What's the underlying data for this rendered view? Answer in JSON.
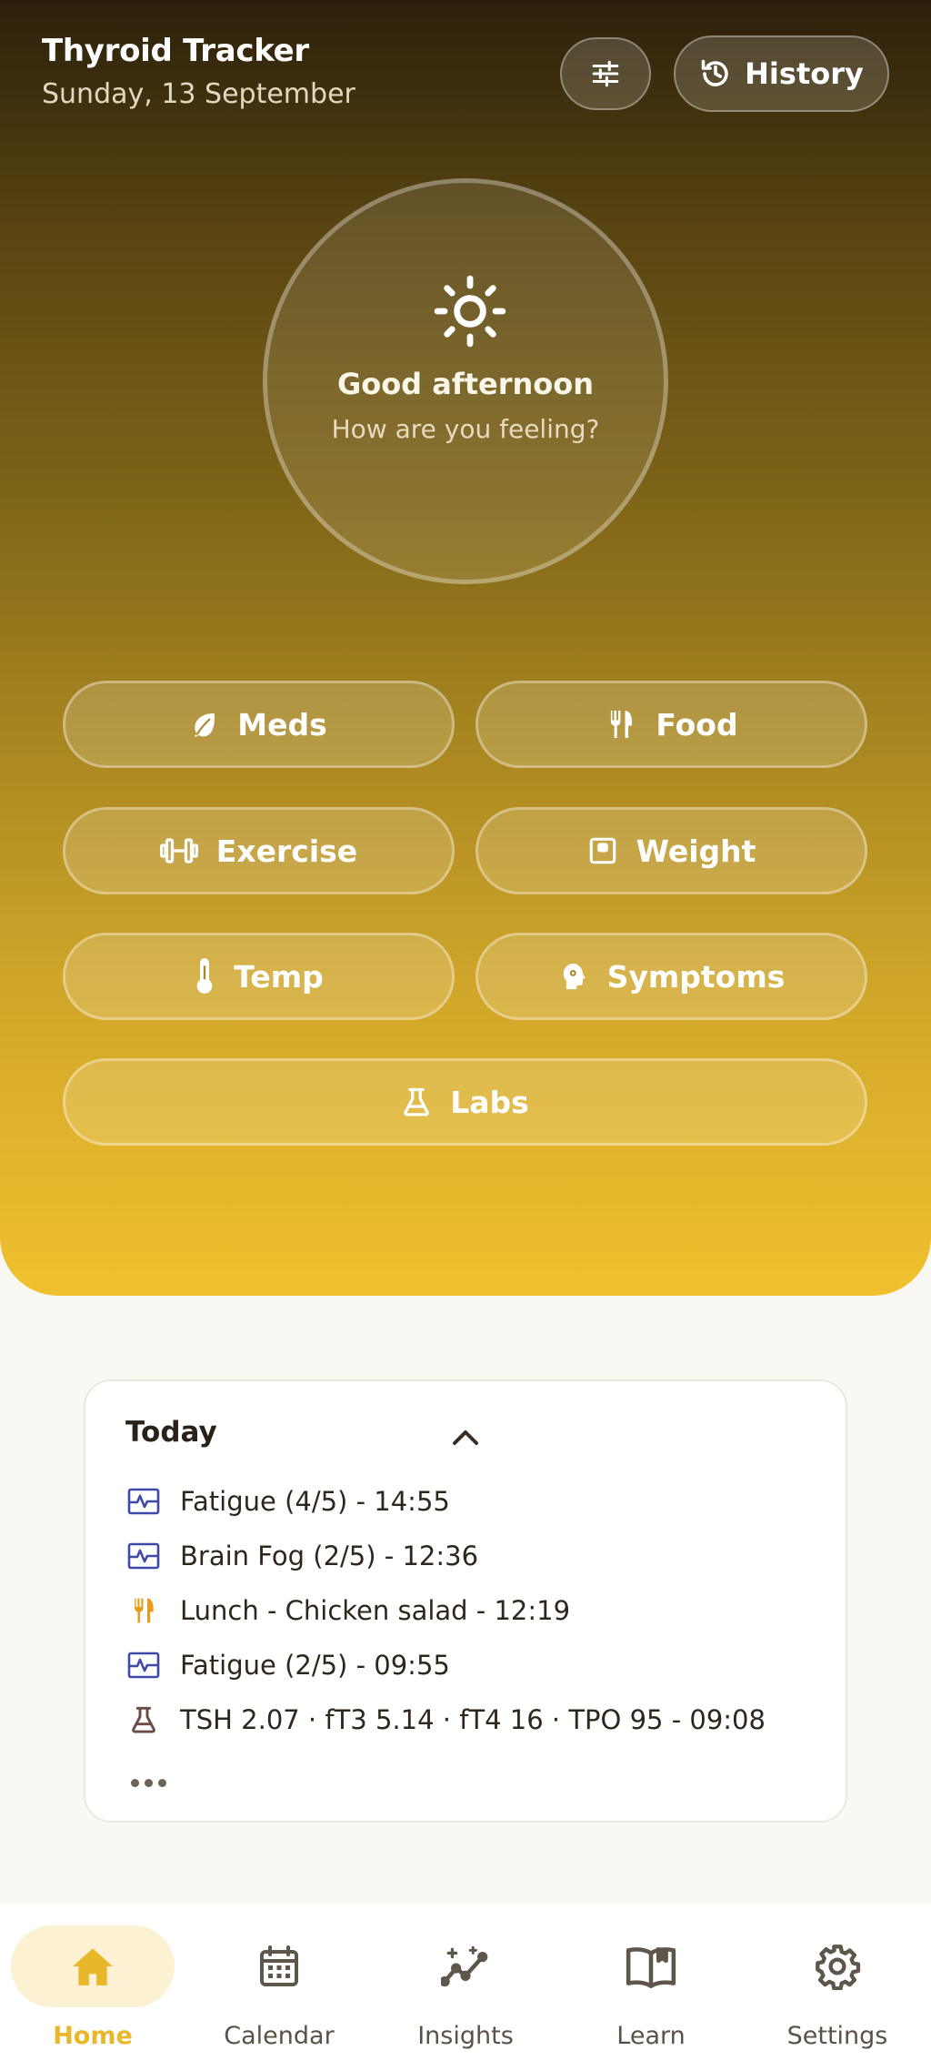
{
  "header": {
    "title": "Thyroid Tracker",
    "date": "Sunday, 13 September",
    "filter_icon": "sliders-icon",
    "history_label": "History",
    "history_icon": "history-icon"
  },
  "mood": {
    "icon": "sun-icon",
    "greeting": "Good afternoon",
    "prompt": "How are you feeling?"
  },
  "quick_actions": [
    {
      "label": "Meds",
      "icon": "leaf-icon"
    },
    {
      "label": "Food",
      "icon": "utensils-icon"
    },
    {
      "label": "Exercise",
      "icon": "dumbbell-icon"
    },
    {
      "label": "Weight",
      "icon": "scale-icon"
    },
    {
      "label": "Temp",
      "icon": "thermometer-icon"
    },
    {
      "label": "Symptoms",
      "icon": "head-gear-icon"
    },
    {
      "label": "Labs",
      "icon": "flask-icon"
    }
  ],
  "today": {
    "title": "Today",
    "collapse_icon": "chevron-up-icon",
    "entries": [
      {
        "text": "Fatigue (4/5) - 14:55",
        "icon": "symptom-chart-icon"
      },
      {
        "text": "Brain Fog (2/5) - 12:36",
        "icon": "symptom-chart-icon"
      },
      {
        "text": "Lunch - Chicken salad - 12:19",
        "icon": "utensils-icon"
      },
      {
        "text": "Fatigue (2/5) - 09:55",
        "icon": "symptom-chart-icon"
      },
      {
        "text": "TSH 2.07 · fT3 5.14 · fT4 16 · TPO 95 - 09:08",
        "icon": "flask-icon"
      }
    ],
    "more_icon": "more-dots-icon"
  },
  "nav": {
    "items": [
      {
        "label": "Home",
        "icon": "home-icon",
        "active": true
      },
      {
        "label": "Calendar",
        "icon": "calendar-icon",
        "active": false
      },
      {
        "label": "Insights",
        "icon": "insights-icon",
        "active": false
      },
      {
        "label": "Learn",
        "icon": "book-icon",
        "active": false
      },
      {
        "label": "Settings",
        "icon": "gear-icon",
        "active": false
      }
    ]
  },
  "colors": {
    "accent": "#f0c12e",
    "hero_top": "#2b200b",
    "symptom_icon": "#3f4aa8",
    "food_icon": "#e79c1c",
    "lab_icon": "#6b4c45",
    "nav_active": "#e9b72a"
  }
}
